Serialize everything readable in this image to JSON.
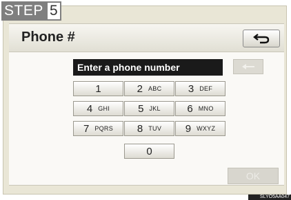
{
  "step": {
    "label": "STEP",
    "number": "5"
  },
  "header": {
    "title": "Phone #",
    "back_icon": "back-arrow-icon"
  },
  "entry": {
    "prompt": "Enter a phone number",
    "delete_icon": "backspace-arrow-icon"
  },
  "keypad": {
    "rows": [
      [
        {
          "num": "1",
          "letters": "",
          "dim": true
        },
        {
          "num": "2",
          "letters": "ABC"
        },
        {
          "num": "3",
          "letters": "DEF"
        }
      ],
      [
        {
          "num": "4",
          "letters": "GHI"
        },
        {
          "num": "5",
          "letters": "JKL"
        },
        {
          "num": "6",
          "letters": "MNO"
        }
      ],
      [
        {
          "num": "7",
          "letters": "PQRS"
        },
        {
          "num": "8",
          "letters": "TUV"
        },
        {
          "num": "9",
          "letters": "WXYZ"
        }
      ],
      [
        {
          "num": "0",
          "letters": ""
        }
      ]
    ]
  },
  "ok_label": "OK",
  "code": "SLYO5AA047"
}
